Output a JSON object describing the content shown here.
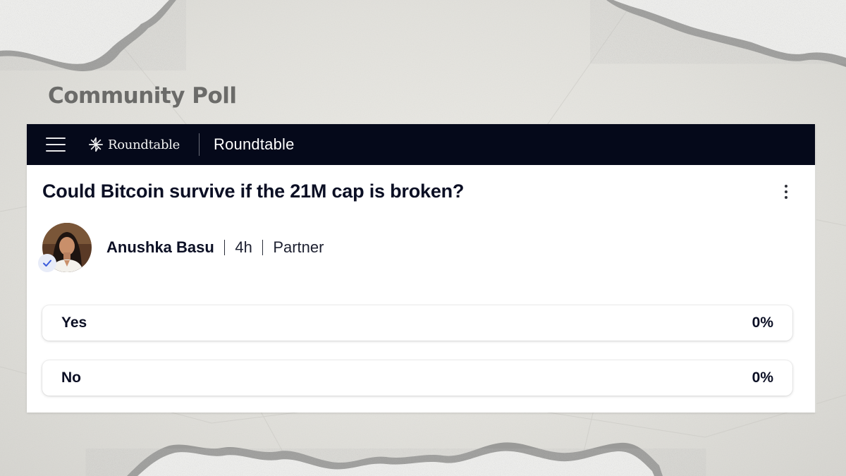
{
  "section_title": "Community Poll",
  "app": {
    "logo_text": "Roundtable",
    "title": "Roundtable"
  },
  "post": {
    "question": "Could Bitcoin survive if the 21M cap is broken?",
    "author": {
      "name": "Anushka Basu",
      "verified": true
    },
    "time": "4h",
    "role": "Partner"
  },
  "poll": {
    "options": [
      {
        "label": "Yes",
        "percent": "0%"
      },
      {
        "label": "No",
        "percent": "0%"
      }
    ]
  },
  "icons": {
    "menu": "hamburger-menu-icon",
    "logo": "sparkle-logo-icon",
    "more": "kebab-menu-icon",
    "verified": "check-icon"
  },
  "colors": {
    "topbar": "#05091a",
    "text": "#0b0f24",
    "section_title": "#6b6b69",
    "verified_check": "#3b5bdb"
  }
}
